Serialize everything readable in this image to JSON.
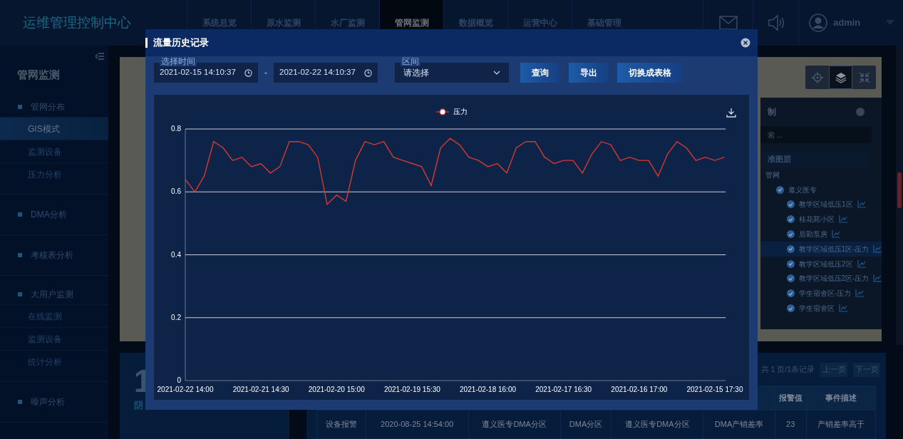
{
  "header": {
    "title": "运维管理控制中心",
    "user": "admin",
    "nav": [
      {
        "label": "系统总览",
        "selected": false
      },
      {
        "label": "原水监测",
        "selected": false
      },
      {
        "label": "水厂监测",
        "selected": false
      },
      {
        "label": "管网监测",
        "selected": true
      },
      {
        "label": "数据概览",
        "selected": false
      },
      {
        "label": "运营中心",
        "selected": false
      },
      {
        "label": "基础管理",
        "selected": false
      }
    ]
  },
  "sidebar": {
    "title": "管网监测",
    "groups": [
      {
        "label": "管网分布",
        "children": [
          {
            "label": "GIS模式",
            "selected": true
          },
          {
            "label": "监测设备",
            "selected": false
          },
          {
            "label": "压力分析",
            "selected": false
          }
        ]
      },
      {
        "label": "DMA分析"
      },
      {
        "label": "考核表分析"
      },
      {
        "label": "大用户监测",
        "children": [
          {
            "label": "在线监测",
            "selected": false
          },
          {
            "label": "监测设备",
            "selected": false
          },
          {
            "label": "统计分析",
            "selected": false
          }
        ]
      },
      {
        "label": "噪声分析"
      }
    ]
  },
  "layer_panel": {
    "title": "制",
    "search_placeholder": "索 ...",
    "section": "准图层",
    "tree": [
      {
        "label": "管网",
        "children": [
          {
            "label": "遵义医专",
            "checked": true,
            "children": [
              {
                "label": "教学区域低压1区",
                "checked": true,
                "selected": false
              },
              {
                "label": "桂花苑小区",
                "checked": true,
                "selected": false
              },
              {
                "label": "后勤泵房",
                "checked": true,
                "selected": false
              },
              {
                "label": "教学区域低压1区-压力",
                "checked": true,
                "selected": true
              },
              {
                "label": "教学区域低压2区",
                "checked": true,
                "selected": false
              },
              {
                "label": "教学区域低压2区-压力",
                "checked": true,
                "selected": false
              },
              {
                "label": "学生宿舍区-压力",
                "checked": true,
                "selected": false
              },
              {
                "label": "学生宿舍区",
                "checked": true,
                "selected": false
              }
            ]
          }
        ]
      }
    ]
  },
  "map_tools": [
    {
      "kind": "locate",
      "selected": false
    },
    {
      "kind": "layers",
      "selected": true
    },
    {
      "kind": "collapse",
      "selected": false
    }
  ],
  "weather": {
    "value": "1",
    "condition": "阴"
  },
  "alarm_table": {
    "pagination": {
      "summary": "共 1 页/1条记录",
      "prev": "上一页",
      "next": "下一页"
    },
    "columns": [
      "",
      "",
      "",
      "",
      "",
      "",
      "报警值",
      "事件描述"
    ],
    "rows": [
      [
        "设备报警",
        "2020-08-25 14:54:00",
        "遵义医专DMA分区",
        "DMA分区",
        "遵义医专DMA分区",
        "DMA产销差率",
        "23",
        "产销差率高于"
      ]
    ]
  },
  "dialog": {
    "title": "流量历史记录",
    "time_label": "选择时间",
    "start": "2021-02-15 14:10:37",
    "separator": "-",
    "end": "2021-02-22 14:10:37",
    "range_label": "区间",
    "range_placeholder": "请选择",
    "buttons": [
      "查询",
      "导出",
      "切换成表格"
    ],
    "chart_data": {
      "type": "line",
      "grid": true,
      "categories": [
        "2021-02-22 14:00",
        null,
        null,
        null,
        null,
        null,
        null,
        null,
        "2021-02-21 14:30",
        null,
        null,
        null,
        null,
        null,
        null,
        null,
        "2021-02-20 15:00",
        null,
        null,
        null,
        null,
        null,
        null,
        null,
        "2021-02-19 15:30",
        null,
        null,
        null,
        null,
        null,
        null,
        null,
        "2021-02-18 16:00",
        null,
        null,
        null,
        null,
        null,
        null,
        null,
        "2021-02-17 16:30",
        null,
        null,
        null,
        null,
        null,
        null,
        null,
        "2021-02-16 17:00",
        null,
        null,
        null,
        null,
        null,
        null,
        null,
        "2021-02-15 17:30",
        null
      ],
      "ylim": [
        0,
        0.8
      ],
      "yticks": [
        0,
        0.2,
        0.4,
        0.6,
        0.8
      ],
      "series": [
        {
          "name": "压力",
          "color": "#d63a2f",
          "values": [
            0.64,
            0.6,
            0.65,
            0.76,
            0.74,
            0.7,
            0.71,
            0.68,
            0.69,
            0.66,
            0.68,
            0.76,
            0.76,
            0.75,
            0.71,
            0.56,
            0.59,
            0.57,
            0.7,
            0.76,
            0.75,
            0.76,
            0.71,
            0.7,
            0.69,
            0.68,
            0.62,
            0.74,
            0.77,
            0.75,
            0.71,
            0.7,
            0.68,
            0.69,
            0.66,
            0.74,
            0.76,
            0.76,
            0.71,
            0.69,
            0.7,
            0.7,
            0.66,
            0.72,
            0.76,
            0.75,
            0.7,
            0.71,
            0.7,
            0.7,
            0.65,
            0.72,
            0.76,
            0.74,
            0.7,
            0.71,
            0.7,
            0.71
          ]
        }
      ]
    }
  }
}
